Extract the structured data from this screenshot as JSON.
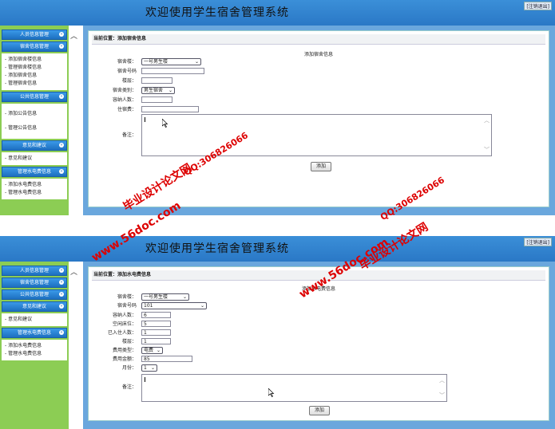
{
  "app": {
    "title": "欢迎使用学生宿舍管理系统",
    "logout": "[注销退出]"
  },
  "sidebar1": {
    "groups": [
      {
        "title": "人员信息管理",
        "items": []
      },
      {
        "title": "宿舍信息管理",
        "items": [
          "添加宿舍楼信息",
          "管理宿舍楼信息",
          "添加宿舍信息",
          "管理宿舍信息"
        ]
      },
      {
        "title": "公共信息管理",
        "items": [
          "添加公告信息",
          "管理公告信息"
        ]
      },
      {
        "title": "意见和建议",
        "items": [
          "意见和建议"
        ]
      },
      {
        "title": "管理水电费信息",
        "items": [
          "添加水电费信息",
          "管理水电费信息"
        ]
      }
    ]
  },
  "sidebar2": {
    "groups": [
      {
        "title": "人员信息管理",
        "items": []
      },
      {
        "title": "宿舍信息管理",
        "items": []
      },
      {
        "title": "公共信息管理",
        "items": []
      },
      {
        "title": "意见和建议",
        "items": [
          "意见和建议"
        ]
      },
      {
        "title": "管理水电费信息",
        "items": [
          "添加水电费信息",
          "管理水电费信息"
        ]
      }
    ]
  },
  "form1": {
    "location": "当前位置：添加宿舍信息",
    "title": "添加宿舍信息",
    "building_label": "宿舍楼：",
    "building_value": "一号男生楼",
    "room_label": "宿舍号码",
    "room_value": "",
    "floor_label": "楼层：",
    "floor_value": "",
    "type_label": "宿舍类别：",
    "type_value": "男生宿舍",
    "capacity_label": "容纳人数：",
    "capacity_value": "",
    "fee_label": "住宿费：",
    "fee_value": "",
    "note_label": "备注：",
    "submit": "添加"
  },
  "form2": {
    "location": "当前位置：添加水电费信息",
    "title": "添加水电费信息",
    "building_label": "宿舍楼：",
    "building_value": "一号男生楼",
    "room_label": "宿舍号码",
    "room_value": "101",
    "capacity_label": "容纳人数：",
    "capacity_value": "6",
    "free_label": "空闲床位：",
    "free_value": "5",
    "occupied_label": "已入住人数：",
    "occupied_value": "1",
    "floor_label": "楼层：",
    "floor_value": "1",
    "feetype_label": "费用类型：",
    "feetype_value": "电费",
    "amount_label": "费用金额：",
    "amount_value": "85",
    "month_label": "月份：",
    "month_value": "1",
    "note_label": "备注：",
    "submit": "添加"
  },
  "watermarks": {
    "site": "www.56doc.com",
    "qq": "QQ:306826066",
    "brand": "毕业设计论文网"
  }
}
